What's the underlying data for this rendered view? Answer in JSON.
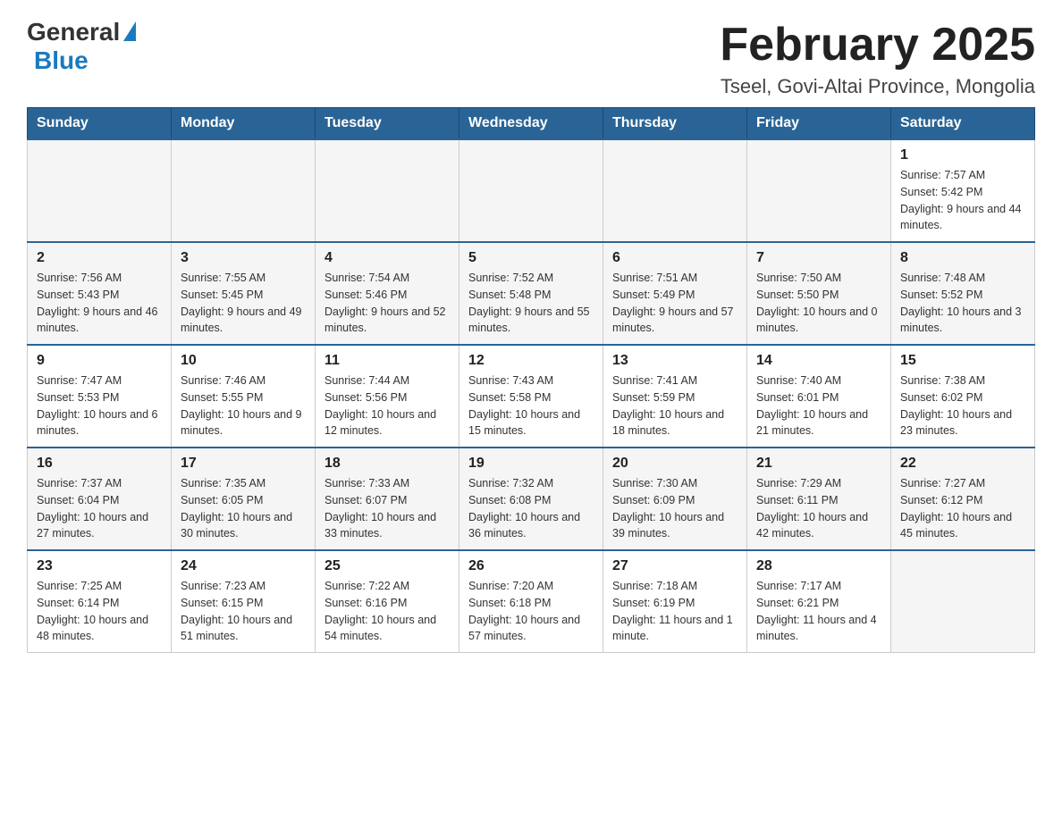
{
  "header": {
    "logo_general": "General",
    "logo_blue": "Blue",
    "month_title": "February 2025",
    "location": "Tseel, Govi-Altai Province, Mongolia"
  },
  "days_of_week": [
    "Sunday",
    "Monday",
    "Tuesday",
    "Wednesday",
    "Thursday",
    "Friday",
    "Saturday"
  ],
  "weeks": [
    [
      {
        "day": "",
        "info": ""
      },
      {
        "day": "",
        "info": ""
      },
      {
        "day": "",
        "info": ""
      },
      {
        "day": "",
        "info": ""
      },
      {
        "day": "",
        "info": ""
      },
      {
        "day": "",
        "info": ""
      },
      {
        "day": "1",
        "info": "Sunrise: 7:57 AM\nSunset: 5:42 PM\nDaylight: 9 hours and 44 minutes."
      }
    ],
    [
      {
        "day": "2",
        "info": "Sunrise: 7:56 AM\nSunset: 5:43 PM\nDaylight: 9 hours and 46 minutes."
      },
      {
        "day": "3",
        "info": "Sunrise: 7:55 AM\nSunset: 5:45 PM\nDaylight: 9 hours and 49 minutes."
      },
      {
        "day": "4",
        "info": "Sunrise: 7:54 AM\nSunset: 5:46 PM\nDaylight: 9 hours and 52 minutes."
      },
      {
        "day": "5",
        "info": "Sunrise: 7:52 AM\nSunset: 5:48 PM\nDaylight: 9 hours and 55 minutes."
      },
      {
        "day": "6",
        "info": "Sunrise: 7:51 AM\nSunset: 5:49 PM\nDaylight: 9 hours and 57 minutes."
      },
      {
        "day": "7",
        "info": "Sunrise: 7:50 AM\nSunset: 5:50 PM\nDaylight: 10 hours and 0 minutes."
      },
      {
        "day": "8",
        "info": "Sunrise: 7:48 AM\nSunset: 5:52 PM\nDaylight: 10 hours and 3 minutes."
      }
    ],
    [
      {
        "day": "9",
        "info": "Sunrise: 7:47 AM\nSunset: 5:53 PM\nDaylight: 10 hours and 6 minutes."
      },
      {
        "day": "10",
        "info": "Sunrise: 7:46 AM\nSunset: 5:55 PM\nDaylight: 10 hours and 9 minutes."
      },
      {
        "day": "11",
        "info": "Sunrise: 7:44 AM\nSunset: 5:56 PM\nDaylight: 10 hours and 12 minutes."
      },
      {
        "day": "12",
        "info": "Sunrise: 7:43 AM\nSunset: 5:58 PM\nDaylight: 10 hours and 15 minutes."
      },
      {
        "day": "13",
        "info": "Sunrise: 7:41 AM\nSunset: 5:59 PM\nDaylight: 10 hours and 18 minutes."
      },
      {
        "day": "14",
        "info": "Sunrise: 7:40 AM\nSunset: 6:01 PM\nDaylight: 10 hours and 21 minutes."
      },
      {
        "day": "15",
        "info": "Sunrise: 7:38 AM\nSunset: 6:02 PM\nDaylight: 10 hours and 23 minutes."
      }
    ],
    [
      {
        "day": "16",
        "info": "Sunrise: 7:37 AM\nSunset: 6:04 PM\nDaylight: 10 hours and 27 minutes."
      },
      {
        "day": "17",
        "info": "Sunrise: 7:35 AM\nSunset: 6:05 PM\nDaylight: 10 hours and 30 minutes."
      },
      {
        "day": "18",
        "info": "Sunrise: 7:33 AM\nSunset: 6:07 PM\nDaylight: 10 hours and 33 minutes."
      },
      {
        "day": "19",
        "info": "Sunrise: 7:32 AM\nSunset: 6:08 PM\nDaylight: 10 hours and 36 minutes."
      },
      {
        "day": "20",
        "info": "Sunrise: 7:30 AM\nSunset: 6:09 PM\nDaylight: 10 hours and 39 minutes."
      },
      {
        "day": "21",
        "info": "Sunrise: 7:29 AM\nSunset: 6:11 PM\nDaylight: 10 hours and 42 minutes."
      },
      {
        "day": "22",
        "info": "Sunrise: 7:27 AM\nSunset: 6:12 PM\nDaylight: 10 hours and 45 minutes."
      }
    ],
    [
      {
        "day": "23",
        "info": "Sunrise: 7:25 AM\nSunset: 6:14 PM\nDaylight: 10 hours and 48 minutes."
      },
      {
        "day": "24",
        "info": "Sunrise: 7:23 AM\nSunset: 6:15 PM\nDaylight: 10 hours and 51 minutes."
      },
      {
        "day": "25",
        "info": "Sunrise: 7:22 AM\nSunset: 6:16 PM\nDaylight: 10 hours and 54 minutes."
      },
      {
        "day": "26",
        "info": "Sunrise: 7:20 AM\nSunset: 6:18 PM\nDaylight: 10 hours and 57 minutes."
      },
      {
        "day": "27",
        "info": "Sunrise: 7:18 AM\nSunset: 6:19 PM\nDaylight: 11 hours and 1 minute."
      },
      {
        "day": "28",
        "info": "Sunrise: 7:17 AM\nSunset: 6:21 PM\nDaylight: 11 hours and 4 minutes."
      },
      {
        "day": "",
        "info": ""
      }
    ]
  ]
}
